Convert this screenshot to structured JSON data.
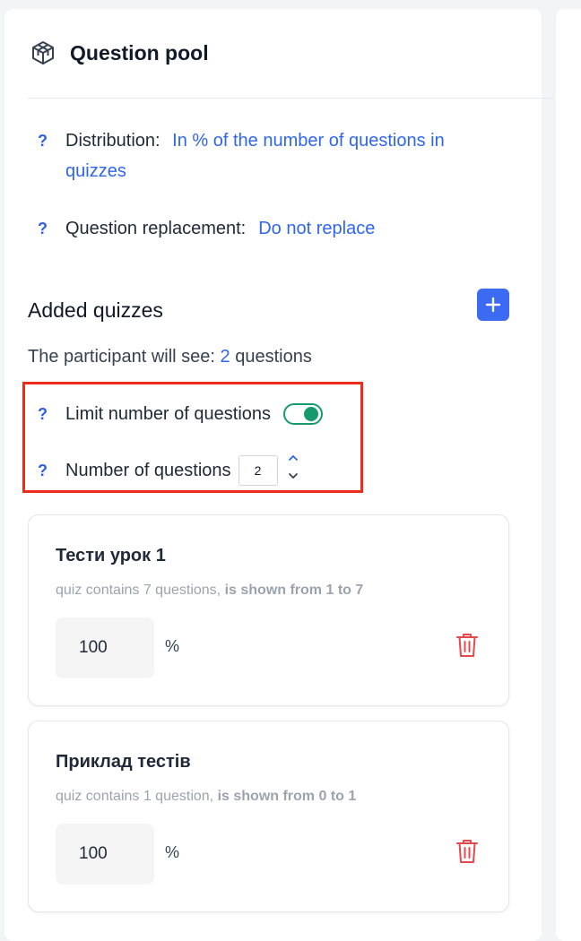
{
  "header": {
    "title": "Question pool",
    "icon": "cube-icon"
  },
  "settings": {
    "distribution": {
      "label": "Distribution:",
      "value_line1": "In % of the number of questions in",
      "value_line2": "quizzes"
    },
    "replacement": {
      "label": "Question replacement:",
      "value": "Do not replace"
    },
    "help_mark": "?"
  },
  "added_quizzes": {
    "title": "Added quizzes",
    "participant_prefix": "The participant will see:",
    "participant_count": "2",
    "participant_suffix": "questions"
  },
  "limit": {
    "label": "Limit number of questions",
    "enabled": true,
    "count_label": "Number of questions",
    "count_value": "2"
  },
  "quizzes": [
    {
      "title": "Тести урок 1",
      "meta_prefix": "quiz contains 7 questions,",
      "meta_range": "is shown from 1 to 7",
      "percent": "100",
      "percent_sign": "%"
    },
    {
      "title": "Приклад тестів",
      "meta_prefix": "quiz contains 1 question,",
      "meta_range": "is shown from 0 to 1",
      "percent": "100",
      "percent_sign": "%"
    }
  ],
  "colors": {
    "accent": "#3c6af2",
    "toggle": "#159a6e",
    "highlight": "#ee2a18",
    "danger": "#e5484d"
  }
}
